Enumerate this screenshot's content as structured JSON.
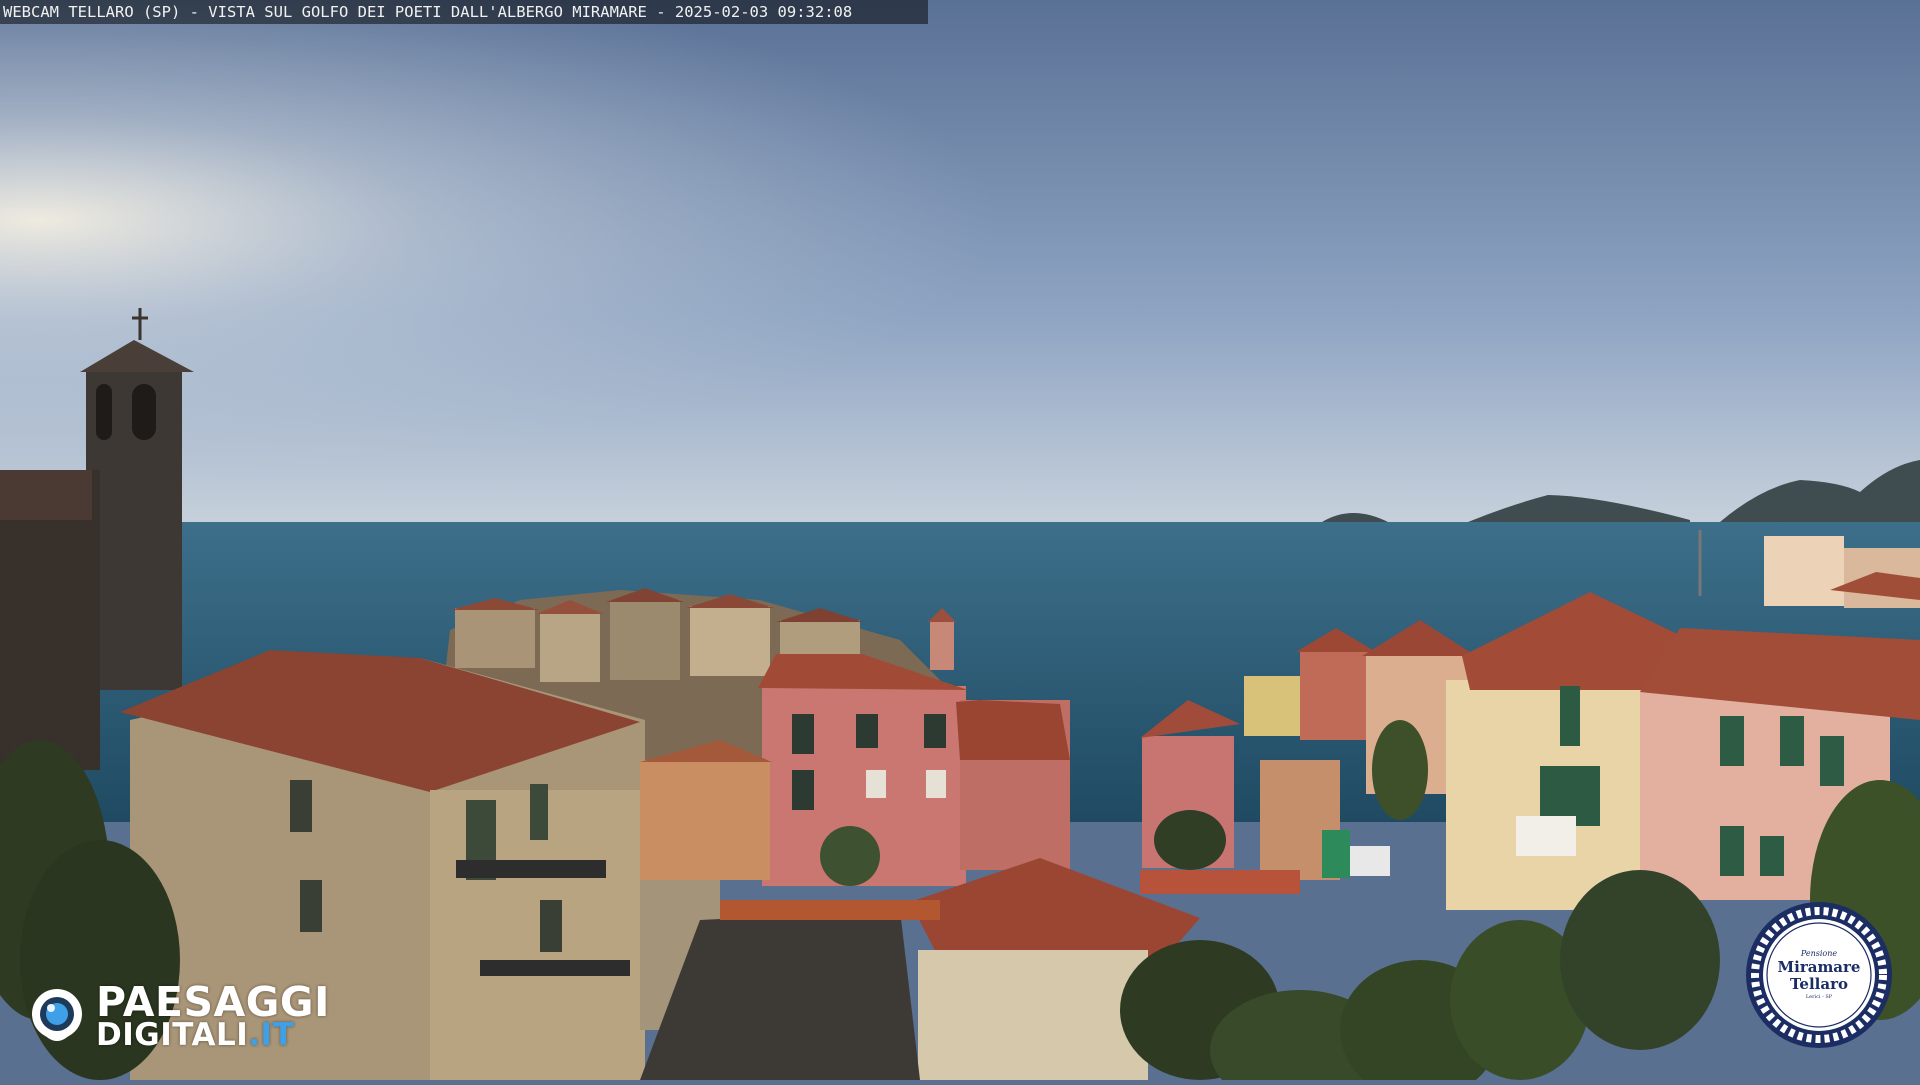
{
  "overlay": {
    "caption": "WEBCAM TELLARO (SP) - VISTA SUL GOLFO DEI POETI DALL'ALBERGO MIRAMARE - 2025-02-03 09:32:08"
  },
  "brand": {
    "name_line1": "PAESAGGI",
    "name_line2": "DIGITALI",
    "name_tld": ".IT",
    "accent_color": "#3fa0e8"
  },
  "badge": {
    "small_text": "Pensione",
    "name_line1": "Miramare",
    "name_line2": "Tellaro",
    "sub_text": "Lerici - SP",
    "ring_color": "#1b2d63"
  },
  "scene": {
    "description_colors": {
      "sky_top": "#5a7196",
      "sky_horizon": "#bcc8d6",
      "sea": "#2e5f78",
      "roof": "#a0472f",
      "wall_pink": "#c9776e",
      "wall_cream": "#d9c79a"
    },
    "elements": [
      "sky",
      "sea",
      "islands",
      "bell-tower",
      "village-houses",
      "trees"
    ]
  }
}
